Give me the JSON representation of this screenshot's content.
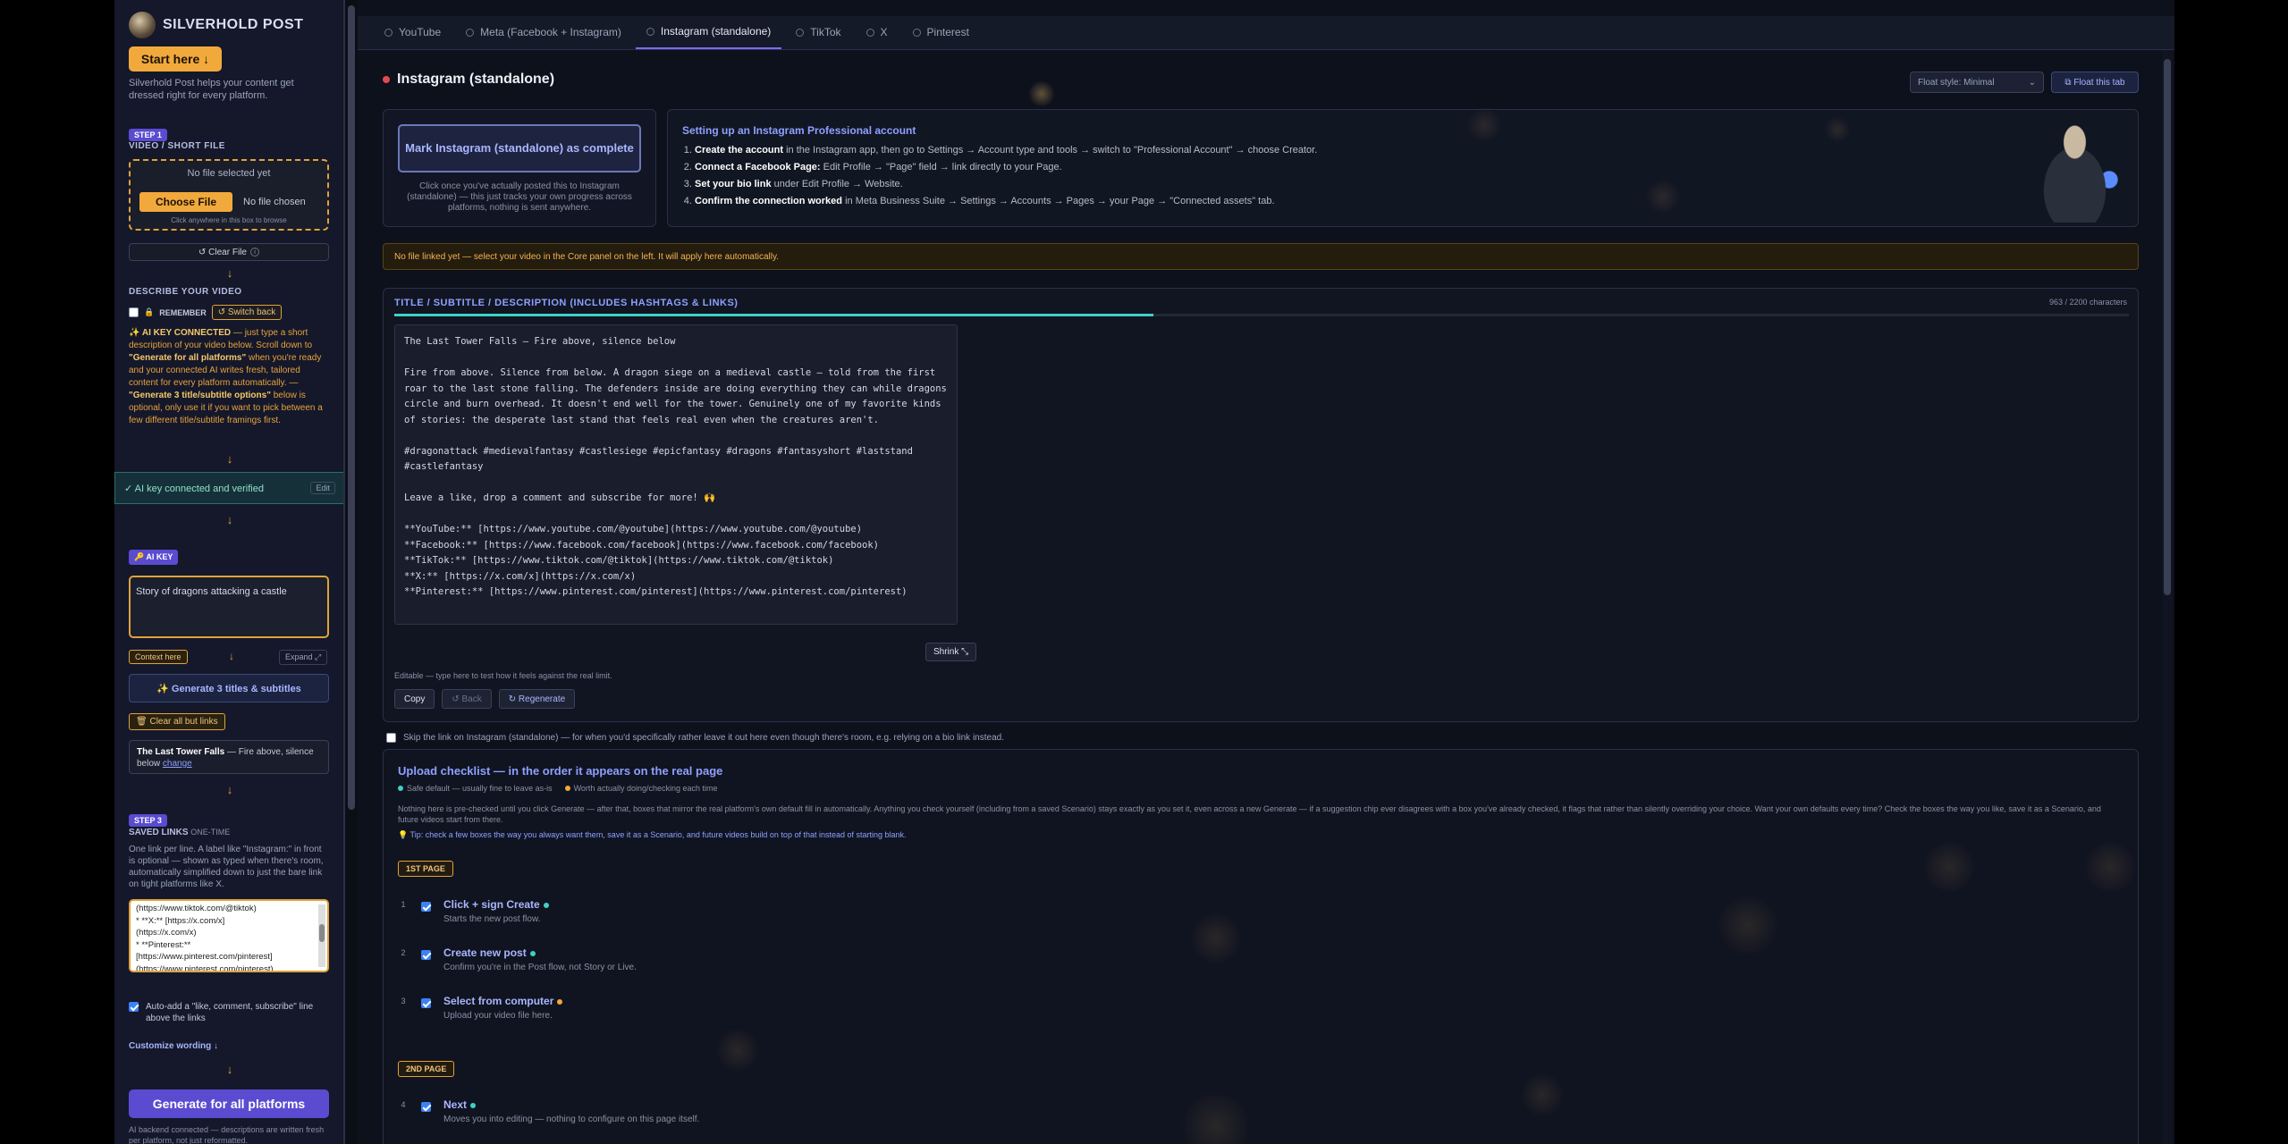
{
  "brand": {
    "name": "SILVERHOLD POST"
  },
  "left": {
    "start_btn": "Start here ↓",
    "intro": "Silverhold Post helps your content get dressed right for every platform.",
    "step1_badge": "STEP 1",
    "video_label": "VIDEO / SHORT FILE",
    "no_file_selected": "No file selected yet",
    "choose_file": "Choose File",
    "no_file_chosen": "No file chosen",
    "drop_hint": "Click anywhere in this box to browse",
    "clear_file": "↺ Clear File",
    "describe_label": "DESCRIBE YOUR VIDEO",
    "remember": "REMEMBER",
    "switch_back": "↺ Switch back",
    "ai_connected_title": "✨ AI KEY CONNECTED",
    "ai_connected_body": " — just type a short description of your video below. Scroll down to ",
    "ai_generate_all": "\"Generate for all platforms\"",
    "ai_connected_body2": " when you're ready and your connected AI writes fresh, tailored content for every platform automatically. — ",
    "ai_gen3": "\"Generate 3 title/subtitle options\"",
    "ai_connected_body3": " below is optional, only use it if you want to pick between a few different title/subtitle framings first.",
    "verified": "✓ AI key connected and verified",
    "edit": "Edit",
    "aikey_badge": "🔑 AI KEY",
    "story_value": "Story of dragons attacking a castle",
    "context_btn": "Context here",
    "expand_btn": "Expand ⤢",
    "gen3_btn": "✨ Generate 3 titles & subtitles",
    "clear_links_btn": "🗑 Clear all but links",
    "preview_title": "The Last Tower Falls",
    "preview_rest": " — Fire above, silence below ",
    "preview_change": "change",
    "step3_badge": "STEP 3",
    "saved_links_label": "SAVED LINKS",
    "saved_links_sub": "ONE-TIME",
    "saved_help": "One link per line. A label like \"Instagram:\" in front is optional — shown as typed when there's room, automatically simplified down to just the bare link on tight platforms like X.",
    "links_lines": [
      "(https://www.tiktok.com/@tiktok)",
      "* **X:** [https://x.com/x]",
      "(https://x.com/x)",
      "* **Pinterest:**",
      "[https://www.pinterest.com/pinterest]",
      "(https://www.pinterest.com/pinterest)"
    ],
    "autoadd": "Auto-add a \"like, comment, subscribe\" line above the links",
    "customize": "Customize wording ↓",
    "generate_all": "Generate for all platforms",
    "backend": "AI backend connected — descriptions are written fresh per platform, not just reformatted."
  },
  "tabs": [
    {
      "label": "YouTube"
    },
    {
      "label": "Meta (Facebook + Instagram)"
    },
    {
      "label": "Instagram (standalone)"
    },
    {
      "label": "TikTok"
    },
    {
      "label": "X"
    },
    {
      "label": "Pinterest"
    }
  ],
  "main": {
    "title": "Instagram (standalone)",
    "float_style": "Float style: Minimal",
    "float_btn": "⧉ Float this tab",
    "mark_btn": "Mark Instagram (standalone) as complete",
    "mark_help": "Click once you've actually posted this to Instagram (standalone) — this just tracks your own progress across platforms, nothing is sent anywhere.",
    "setup_title": "Setting up an Instagram Professional account",
    "setup_steps": [
      {
        "b": "Create the account",
        "t": " in the Instagram app, then go to Settings → Account type and tools → switch to \"Professional Account\" → choose Creator."
      },
      {
        "b": "Connect a Facebook Page:",
        "t": " Edit Profile → \"Page\" field → link directly to your Page."
      },
      {
        "b": "Set your bio link",
        "t": " under Edit Profile → Website."
      },
      {
        "b": "Confirm the connection worked",
        "t": " in Meta Business Suite → Settings → Accounts → Pages → your Page → \"Connected assets\" tab."
      }
    ],
    "nofile_bar": "No file linked yet — select your video in the Core panel on the left. It will apply here automatically.",
    "title_label": "TITLE / SUBTITLE / DESCRIPTION (INCLUDES HASHTAGS & LINKS)",
    "char_count": "963 / 2200 characters",
    "char_fraction": 0.4377,
    "description": "The Last Tower Falls — Fire above, silence below\n\nFire from above. Silence from below. A dragon siege on a medieval castle — told from the first roar to the last stone falling. The defenders inside are doing everything they can while dragons circle and burn overhead. It doesn't end well for the tower. Genuinely one of my favorite kinds of stories: the desperate last stand that feels real even when the creatures aren't.\n\n#dragonattack #medievalfantasy #castlesiege #epicfantasy #dragons #fantasyshort #laststand #castlefantasy\n\nLeave a like, drop a comment and subscribe for more! 🙌\n\n**YouTube:** [https://www.youtube.com/@youtube](https://www.youtube.com/@youtube)\n**Facebook:** [https://www.facebook.com/facebook](https://www.facebook.com/facebook)\n**TikTok:** [https://www.tiktok.com/@tiktok](https://www.tiktok.com/@tiktok)\n**X:** [https://x.com/x](https://x.com/x)\n**Pinterest:** [https://www.pinterest.com/pinterest](https://www.pinterest.com/pinterest)",
    "shrink": "Shrink ⤡",
    "editable": "Editable — type here to test how it feels against the real limit.",
    "copy": "Copy",
    "back": "↺ Back",
    "regenerate": "↻ Regenerate",
    "skip_link": "Skip the link on Instagram (standalone) — for when you'd specifically rather leave it out here even though there's room, e.g. relying on a bio link instead.",
    "checklist_title": "Upload checklist — in the order it appears on the real page",
    "legend_safe": "Safe default — usually fine to leave as-is",
    "legend_worth": "Worth actually doing/checking each time",
    "checklist_help": "Nothing here is pre-checked until you click Generate — after that, boxes that mirror the real platform's own default fill in automatically. Anything you check yourself (including from a saved Scenario) stays exactly as you set it, even across a new Generate — if a suggestion chip ever disagrees with a box you've already checked, it flags that rather than silently overriding your choice. Want your own defaults every time? Check the boxes the way you like, save it as a Scenario, and future videos start from there.",
    "checklist_tip": "💡 Tip: check a few boxes the way you always want them, save it as a Scenario, and future videos build on top of that instead of starting blank.",
    "page1": "1ST PAGE",
    "page2": "2ND PAGE",
    "items": [
      {
        "num": "1",
        "title": "Click + sign Create",
        "sub": "Starts the new post flow.",
        "kind": "safe"
      },
      {
        "num": "2",
        "title": "Create new post",
        "sub": "Confirm you're in the Post flow, not Story or Live.",
        "kind": "safe"
      },
      {
        "num": "3",
        "title": "Select from computer",
        "sub": "Upload your video file here.",
        "kind": "worth"
      },
      {
        "num": "4",
        "title": "Next",
        "sub": "Moves you into editing — nothing to configure on this page itself.",
        "kind": "safe"
      }
    ]
  },
  "colors": {
    "safe": "#3fd0c8",
    "worth": "#f2a93b",
    "accent": "#7b6cff"
  }
}
